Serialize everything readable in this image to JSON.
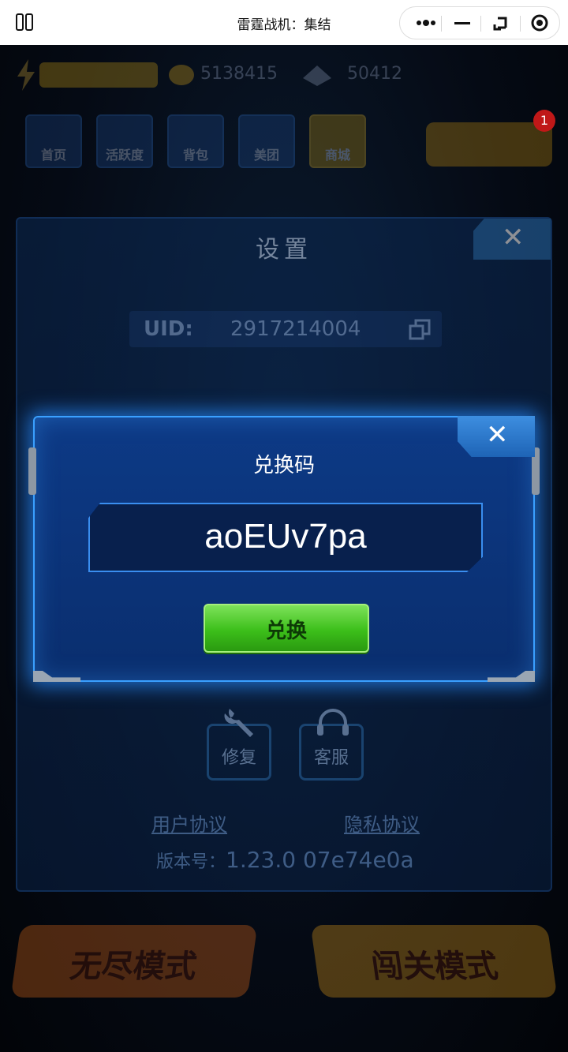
{
  "top_bar": {
    "title": "雷霆战机：集结"
  },
  "hud": {
    "coins": "5138415",
    "gems": "50412",
    "nav_tiles": [
      "首页",
      "活跃度",
      "背包",
      "美团",
      "商城"
    ],
    "sign_badge": "1"
  },
  "settings": {
    "title": "设置",
    "close_label": "✕",
    "uid_label": "UID:",
    "uid_value": "2917214004",
    "repair_label": "修复",
    "support_label": "客服",
    "user_agreement": "用户协议",
    "privacy_policy": "隐私协议",
    "version_label": "版本号：",
    "version_value": "1.23.0  07e74e0a"
  },
  "redeem_dialog": {
    "title": "兑换码",
    "close_label": "✕",
    "code_value": "aoEUv7pa",
    "redeem_label": "兑换"
  },
  "bottom_modes": {
    "endless": "无尽模式",
    "stage": "闯关模式"
  },
  "colors": {
    "dialog_border": "#3aa0ff",
    "redeem_button": "#3cbf1a",
    "panel_bg": "#0a2247"
  }
}
